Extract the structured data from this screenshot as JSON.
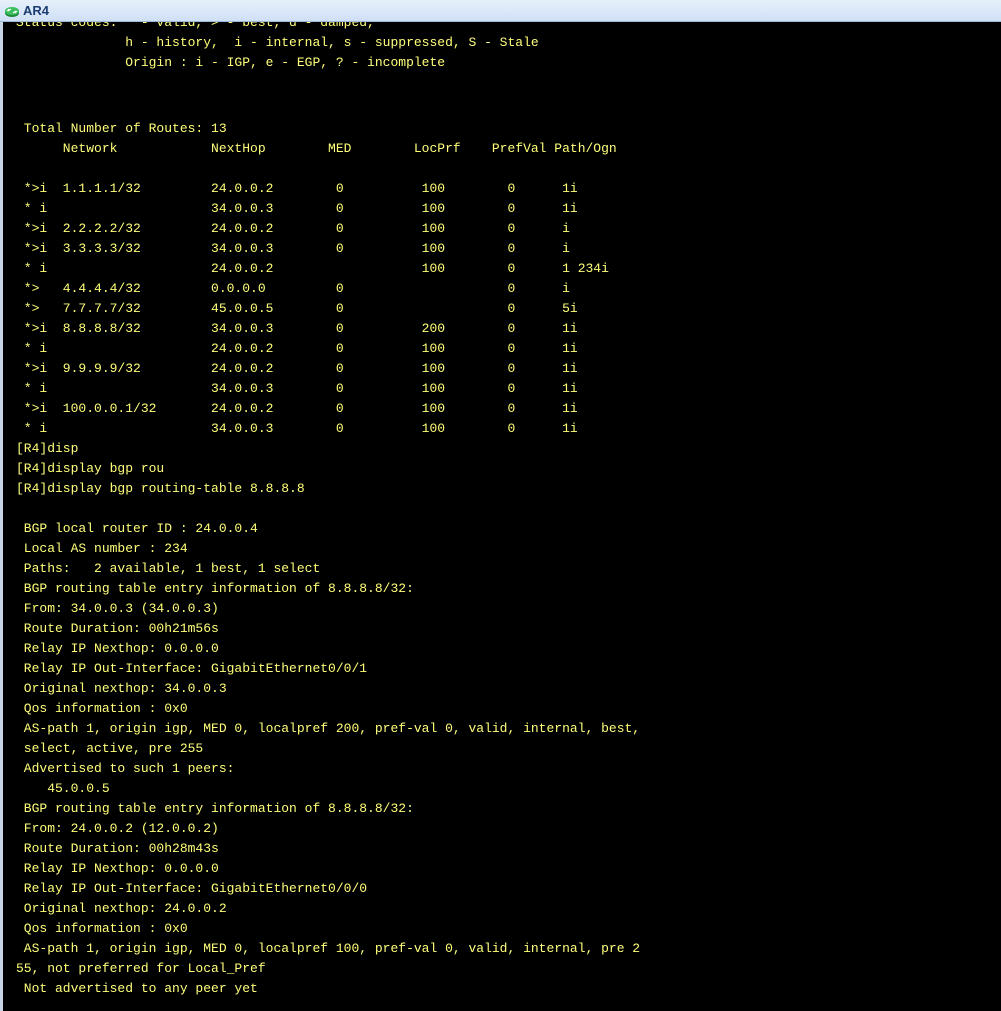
{
  "window": {
    "title": "AR4"
  },
  "terminal": {
    "lines": [
      "Status codes: * - valid, > - best, d - damped,",
      "              h - history,  i - internal, s - suppressed, S - Stale",
      "              Origin : i - IGP, e - EGP, ? - incomplete",
      "",
      "",
      " Total Number of Routes: 13",
      "      Network            NextHop        MED        LocPrf    PrefVal Path/Ogn",
      "",
      " *>i  1.1.1.1/32         24.0.0.2        0          100        0      1i",
      " * i                     34.0.0.3        0          100        0      1i",
      " *>i  2.2.2.2/32         24.0.0.2        0          100        0      i",
      " *>i  3.3.3.3/32         34.0.0.3        0          100        0      i",
      " * i                     24.0.0.2                   100        0      1 234i",
      " *>   4.4.4.4/32         0.0.0.0         0                     0      i",
      " *>   7.7.7.7/32         45.0.0.5        0                     0      5i",
      " *>i  8.8.8.8/32         34.0.0.3        0          200        0      1i",
      " * i                     24.0.0.2        0          100        0      1i",
      " *>i  9.9.9.9/32         24.0.0.2        0          100        0      1i",
      " * i                     34.0.0.3        0          100        0      1i",
      " *>i  100.0.0.1/32       24.0.0.2        0          100        0      1i",
      " * i                     34.0.0.3        0          100        0      1i",
      "[R4]disp",
      "[R4]display bgp rou",
      "[R4]display bgp routing-table 8.8.8.8",
      "",
      " BGP local router ID : 24.0.0.4",
      " Local AS number : 234",
      " Paths:   2 available, 1 best, 1 select",
      " BGP routing table entry information of 8.8.8.8/32:",
      " From: 34.0.0.3 (34.0.0.3)",
      " Route Duration: 00h21m56s",
      " Relay IP Nexthop: 0.0.0.0",
      " Relay IP Out-Interface: GigabitEthernet0/0/1",
      " Original nexthop: 34.0.0.3",
      " Qos information : 0x0",
      " AS-path 1, origin igp, MED 0, localpref 200, pref-val 0, valid, internal, best,",
      " select, active, pre 255",
      " Advertised to such 1 peers:",
      "    45.0.0.5",
      " BGP routing table entry information of 8.8.8.8/32:",
      " From: 24.0.0.2 (12.0.0.2)",
      " Route Duration: 00h28m43s",
      " Relay IP Nexthop: 0.0.0.0",
      " Relay IP Out-Interface: GigabitEthernet0/0/0",
      " Original nexthop: 24.0.0.2",
      " Qos information : 0x0",
      " AS-path 1, origin igp, MED 0, localpref 100, pref-val 0, valid, internal, pre 2",
      "55, not preferred for Local_Pref",
      " Not advertised to any peer yet"
    ]
  }
}
